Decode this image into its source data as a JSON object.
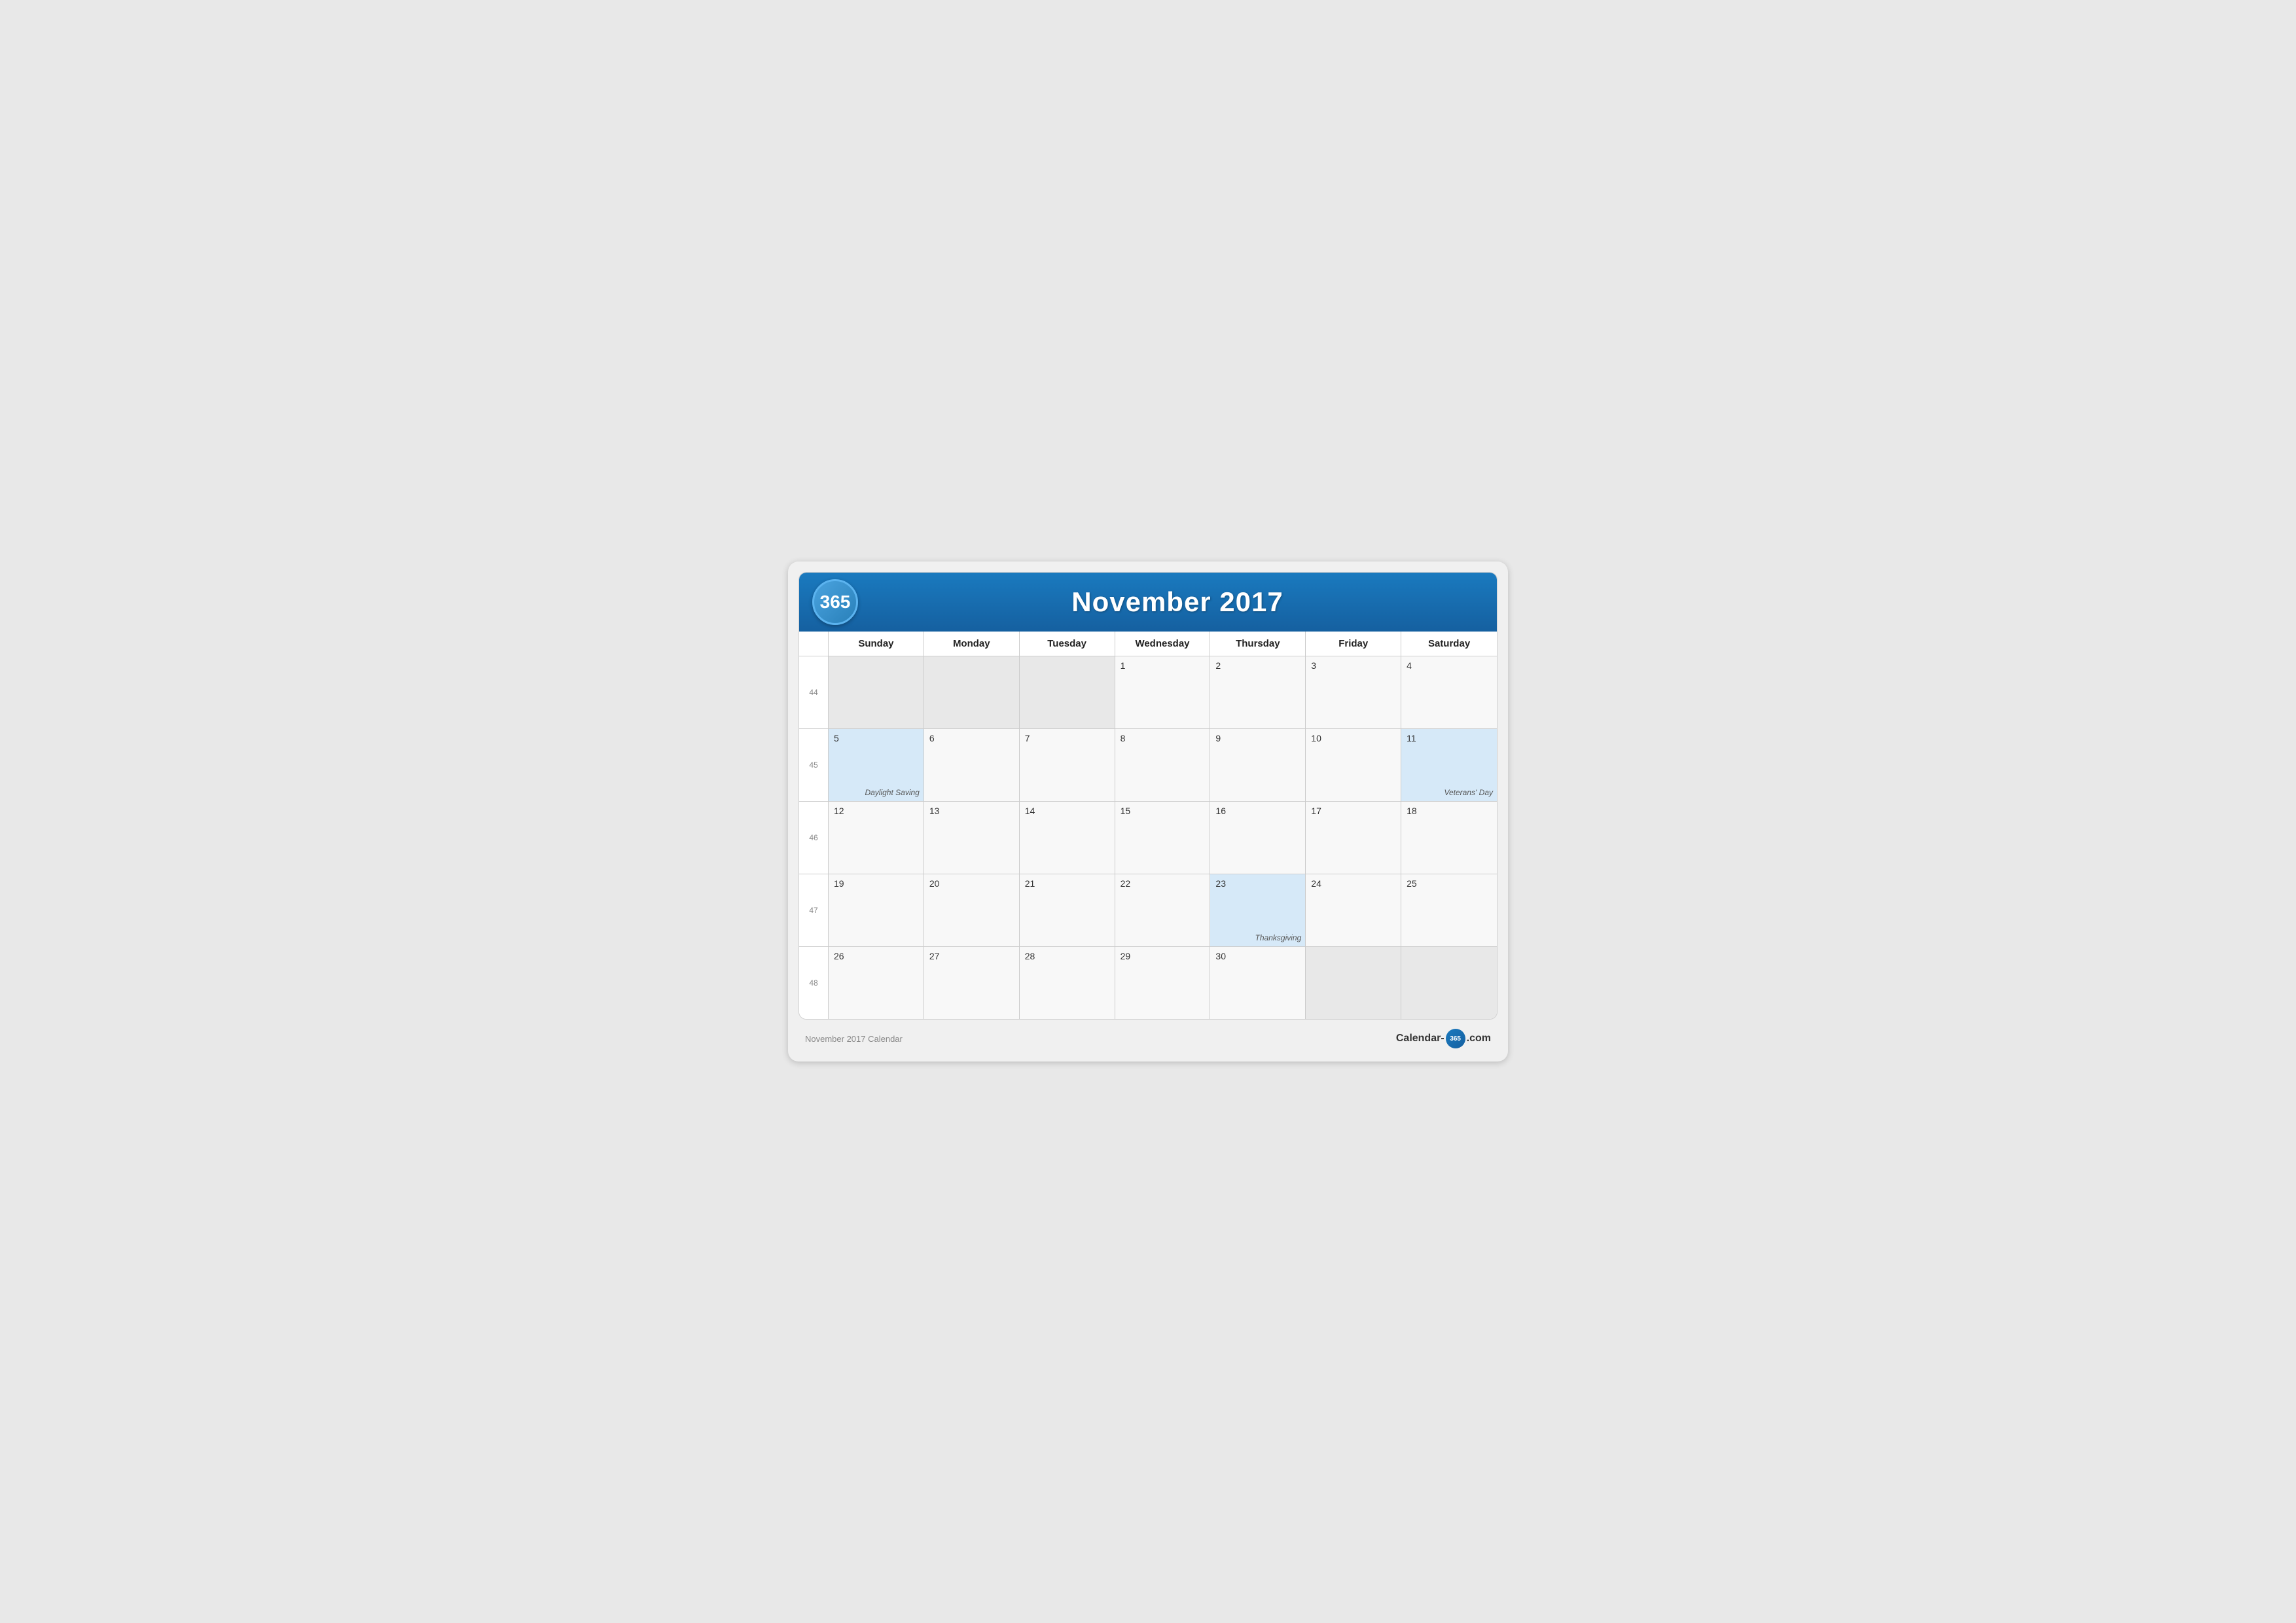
{
  "header": {
    "logo_text": "365",
    "title": "November 2017"
  },
  "day_names": [
    "Sunday",
    "Monday",
    "Tuesday",
    "Wednesday",
    "Thursday",
    "Friday",
    "Saturday"
  ],
  "weeks": [
    {
      "week_num": 44,
      "days": [
        {
          "date": "",
          "month_status": "out-of-month",
          "highlighted": false,
          "holiday": ""
        },
        {
          "date": "",
          "month_status": "out-of-month",
          "highlighted": false,
          "holiday": ""
        },
        {
          "date": "",
          "month_status": "out-of-month",
          "highlighted": false,
          "holiday": ""
        },
        {
          "date": "1",
          "month_status": "current-month",
          "highlighted": false,
          "holiday": ""
        },
        {
          "date": "2",
          "month_status": "current-month",
          "highlighted": false,
          "holiday": ""
        },
        {
          "date": "3",
          "month_status": "current-month",
          "highlighted": false,
          "holiday": ""
        },
        {
          "date": "4",
          "month_status": "current-month",
          "highlighted": false,
          "holiday": ""
        }
      ]
    },
    {
      "week_num": 45,
      "days": [
        {
          "date": "5",
          "month_status": "current-month",
          "highlighted": true,
          "holiday": "Daylight Saving"
        },
        {
          "date": "6",
          "month_status": "current-month",
          "highlighted": false,
          "holiday": ""
        },
        {
          "date": "7",
          "month_status": "current-month",
          "highlighted": false,
          "holiday": ""
        },
        {
          "date": "8",
          "month_status": "current-month",
          "highlighted": false,
          "holiday": ""
        },
        {
          "date": "9",
          "month_status": "current-month",
          "highlighted": false,
          "holiday": ""
        },
        {
          "date": "10",
          "month_status": "current-month",
          "highlighted": false,
          "holiday": ""
        },
        {
          "date": "11",
          "month_status": "current-month",
          "highlighted": true,
          "holiday": "Veterans' Day"
        }
      ]
    },
    {
      "week_num": 46,
      "days": [
        {
          "date": "12",
          "month_status": "current-month",
          "highlighted": false,
          "holiday": ""
        },
        {
          "date": "13",
          "month_status": "current-month",
          "highlighted": false,
          "holiday": ""
        },
        {
          "date": "14",
          "month_status": "current-month",
          "highlighted": false,
          "holiday": ""
        },
        {
          "date": "15",
          "month_status": "current-month",
          "highlighted": false,
          "holiday": ""
        },
        {
          "date": "16",
          "month_status": "current-month",
          "highlighted": false,
          "holiday": ""
        },
        {
          "date": "17",
          "month_status": "current-month",
          "highlighted": false,
          "holiday": ""
        },
        {
          "date": "18",
          "month_status": "current-month",
          "highlighted": false,
          "holiday": ""
        }
      ]
    },
    {
      "week_num": 47,
      "days": [
        {
          "date": "19",
          "month_status": "current-month",
          "highlighted": false,
          "holiday": ""
        },
        {
          "date": "20",
          "month_status": "current-month",
          "highlighted": false,
          "holiday": ""
        },
        {
          "date": "21",
          "month_status": "current-month",
          "highlighted": false,
          "holiday": ""
        },
        {
          "date": "22",
          "month_status": "current-month",
          "highlighted": false,
          "holiday": ""
        },
        {
          "date": "23",
          "month_status": "current-month",
          "highlighted": true,
          "holiday": "Thanksgiving"
        },
        {
          "date": "24",
          "month_status": "current-month",
          "highlighted": false,
          "holiday": ""
        },
        {
          "date": "25",
          "month_status": "current-month",
          "highlighted": false,
          "holiday": ""
        }
      ]
    },
    {
      "week_num": 48,
      "days": [
        {
          "date": "26",
          "month_status": "current-month",
          "highlighted": false,
          "holiday": ""
        },
        {
          "date": "27",
          "month_status": "current-month",
          "highlighted": false,
          "holiday": ""
        },
        {
          "date": "28",
          "month_status": "current-month",
          "highlighted": false,
          "holiday": ""
        },
        {
          "date": "29",
          "month_status": "current-month",
          "highlighted": false,
          "holiday": ""
        },
        {
          "date": "30",
          "month_status": "current-month",
          "highlighted": false,
          "holiday": ""
        },
        {
          "date": "",
          "month_status": "out-of-month",
          "highlighted": false,
          "holiday": ""
        },
        {
          "date": "",
          "month_status": "out-of-month",
          "highlighted": false,
          "holiday": ""
        }
      ]
    }
  ],
  "footer": {
    "left_text": "November 2017 Calendar",
    "right_text_before": "Calendar-",
    "right_badge": "365",
    "right_text_after": ".com"
  }
}
